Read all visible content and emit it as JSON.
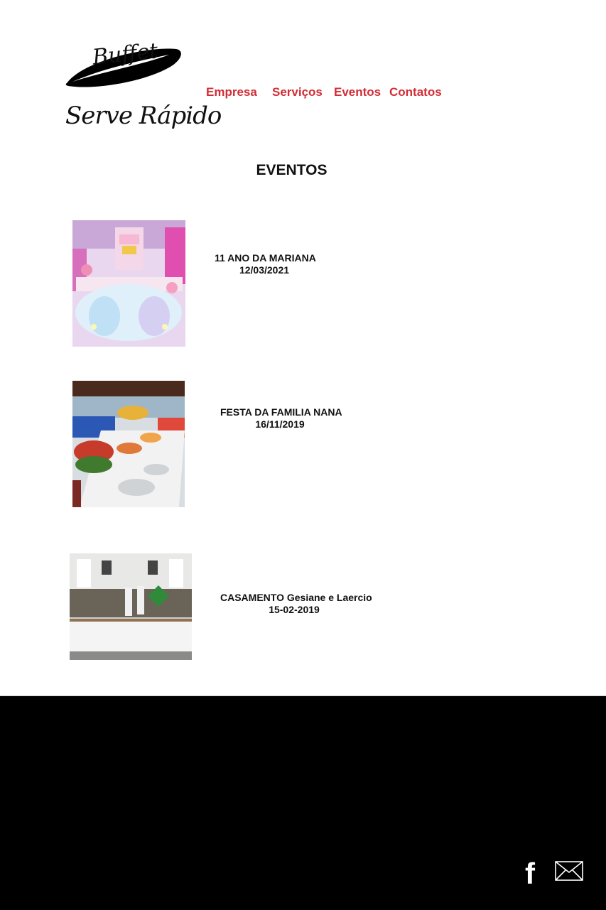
{
  "brand": {
    "logo_top": "Buffet",
    "logo_bottom": "Serve Rápido"
  },
  "nav": {
    "empresa": "Empresa",
    "servicos": "Serviços",
    "eventos": "Eventos",
    "contatos": "Contatos",
    "color": "#d12d36"
  },
  "page": {
    "title": "EVENTOS"
  },
  "events": [
    {
      "name": "11 ANO DA MARIANA",
      "date": "12/03/2021"
    },
    {
      "name": "FESTA DA FAMILIA NANA",
      "date": "16/11/2019"
    },
    {
      "name": "CASAMENTO Gesiane e Laercio",
      "date": "15-02-2019"
    }
  ],
  "footer": {
    "background": "#000000",
    "icons": [
      "facebook-icon",
      "mail-icon"
    ],
    "facebook_glyph": "f"
  }
}
